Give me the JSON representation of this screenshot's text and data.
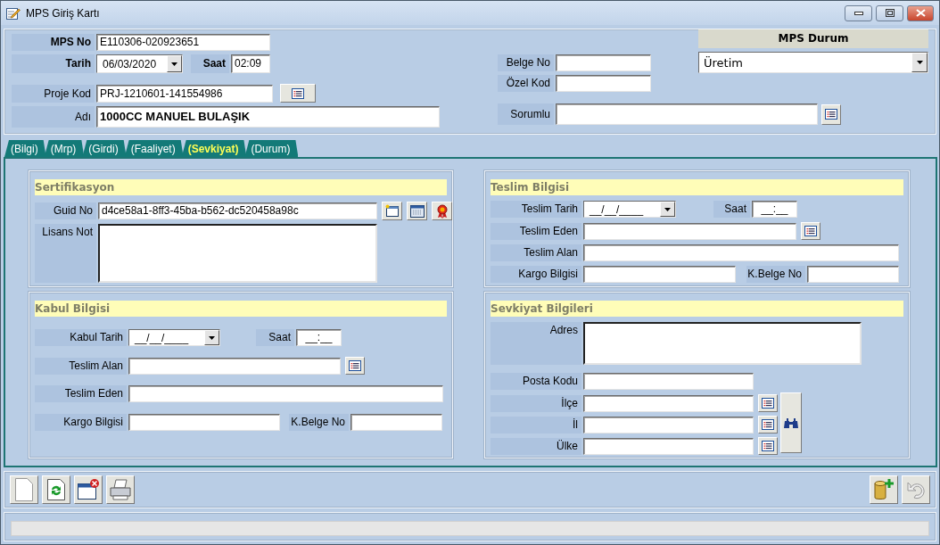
{
  "window": {
    "title": "MPS Giriş Kartı"
  },
  "header": {
    "mps_no": {
      "label": "MPS No",
      "value": "E110306-020923651"
    },
    "tarih": {
      "label": "Tarih",
      "value": "06/03/2020"
    },
    "saat": {
      "label": "Saat",
      "value": "02:09"
    },
    "proje_kod": {
      "label": "Proje Kod",
      "value": "PRJ-1210601-141554986"
    },
    "adi": {
      "label": "Adı",
      "value": "1000CC MANUEL BULAŞIK"
    },
    "belge_no": {
      "label": "Belge No"
    },
    "ozel_kod": {
      "label": "Özel Kod"
    },
    "sorumlu": {
      "label": "Sorumlu"
    },
    "mps_durum": {
      "title": "MPS Durum",
      "value": "Üretim"
    }
  },
  "tabs": [
    {
      "label": "(Bilgi)",
      "selected": false
    },
    {
      "label": "(Mrp)",
      "selected": false
    },
    {
      "label": "(Girdi)",
      "selected": false
    },
    {
      "label": "(Faaliyet)",
      "selected": false
    },
    {
      "label": "(Sevkiyat)",
      "selected": true
    },
    {
      "label": "(Durum)",
      "selected": false
    }
  ],
  "sertifikasyon": {
    "title": "Sertifikasyon",
    "guid_no": {
      "label": "Guid No",
      "value": "d4ce58a1-8ff3-45ba-b562-dc520458a98c"
    },
    "lisans_not": {
      "label": "Lisans Not"
    }
  },
  "kabul_bilgisi": {
    "title": "Kabul Bilgisi",
    "kabul_tarih": {
      "label": "Kabul Tarih",
      "value": "__/__/____"
    },
    "saat": {
      "label": "Saat",
      "value": "__:__"
    },
    "teslim_alan": {
      "label": "Teslim Alan"
    },
    "teslim_eden": {
      "label": "Teslim Eden"
    },
    "kargo_bilgisi": {
      "label": "Kargo Bilgisi"
    },
    "k_belge_no": {
      "label": "K.Belge No"
    }
  },
  "teslim_bilgisi": {
    "title": "Teslim Bilgisi",
    "teslim_tarih": {
      "label": "Teslim Tarih",
      "value": "__/__/____"
    },
    "saat": {
      "label": "Saat",
      "value": "__:__"
    },
    "teslim_eden": {
      "label": "Teslim Eden"
    },
    "teslim_alan": {
      "label": "Teslim Alan"
    },
    "kargo_bilgisi": {
      "label": "Kargo Bilgisi"
    },
    "k_belge_no": {
      "label": "K.Belge No"
    }
  },
  "sevkiyat_bilgileri": {
    "title": "Sevkiyat Bilgileri",
    "adres": {
      "label": "Adres"
    },
    "posta_kodu": {
      "label": "Posta Kodu"
    },
    "ilce": {
      "label": "İlçe"
    },
    "il": {
      "label": "İl"
    },
    "ulke": {
      "label": "Ülke"
    }
  }
}
